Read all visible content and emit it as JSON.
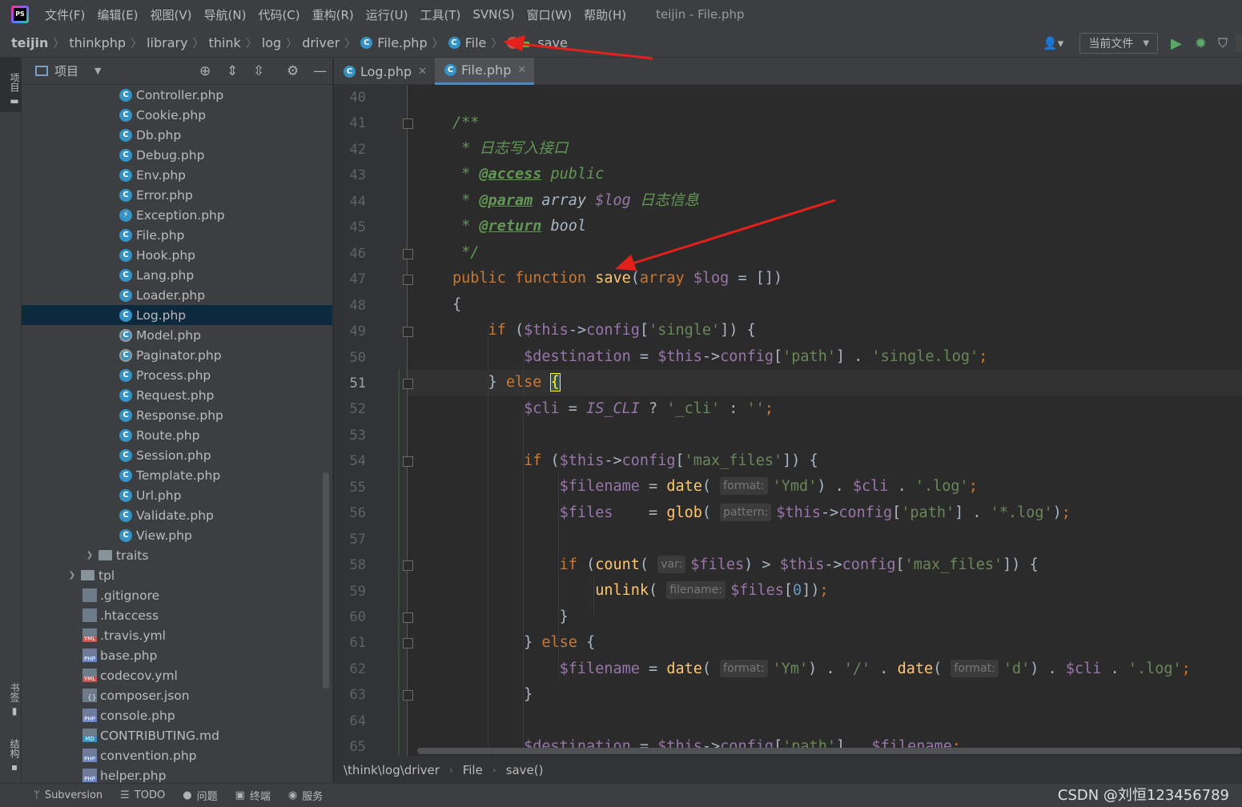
{
  "window_title": "teijin - File.php",
  "menu": [
    "文件(F)",
    "编辑(E)",
    "视图(V)",
    "导航(N)",
    "代码(C)",
    "重构(R)",
    "运行(U)",
    "工具(T)",
    "SVN(S)",
    "窗口(W)",
    "帮助(H)"
  ],
  "navbar": {
    "crumbs": [
      "teijin",
      "thinkphp",
      "library",
      "think",
      "log",
      "driver",
      "File.php",
      "File",
      "save"
    ],
    "run_config": "当前文件"
  },
  "left_stripe": {
    "project": "项目",
    "bookmarks": "书签",
    "structure": "结构"
  },
  "project_panel": {
    "title": "项目",
    "files": [
      "Controller.php",
      "Cookie.php",
      "Db.php",
      "Debug.php",
      "Env.php",
      "Error.php",
      "Exception.php",
      "File.php",
      "Hook.php",
      "Lang.php",
      "Loader.php",
      "Log.php",
      "Model.php",
      "Paginator.php",
      "Process.php",
      "Request.php",
      "Response.php",
      "Route.php",
      "Session.php",
      "Template.php",
      "Url.php",
      "Validate.php",
      "View.php"
    ],
    "folders": [
      "traits",
      "tpl"
    ],
    "root_files": [
      ".gitignore",
      ".htaccess",
      ".travis.yml",
      "base.php",
      "codecov.yml",
      "composer.json",
      "console.php",
      "CONTRIBUTING.md",
      "convention.php",
      "helper.php"
    ],
    "selected": "Log.php"
  },
  "editor_tabs": [
    {
      "label": "Log.php",
      "active": false
    },
    {
      "label": "File.php",
      "active": true
    }
  ],
  "editor": {
    "current_line": 51,
    "line_numbers": [
      "40",
      "41",
      "42",
      "43",
      "44",
      "45",
      "46",
      "47",
      "48",
      "49",
      "50",
      "51",
      "52",
      "53",
      "54",
      "55",
      "56",
      "57",
      "58",
      "59",
      "60",
      "61",
      "62",
      "63",
      "64",
      "65"
    ],
    "comment_cn_1": "日志写入接口",
    "comment_cn_2": "日志信息",
    "hints": {
      "format": "format:",
      "pattern": "pattern:",
      "var": "var:",
      "filename": "filename:"
    }
  },
  "editor_breadcrumb": [
    "\\think\\log\\driver",
    "File",
    "save()"
  ],
  "bottom_tools": [
    "Subversion",
    "TODO",
    "问题",
    "终端",
    "服务"
  ],
  "watermark": "CSDN @刘恒123456789",
  "colors": {
    "keyword": "#cc7832",
    "function": "#ffc66d",
    "variable": "#9876aa",
    "string": "#6a8759",
    "comment": "#629755",
    "annotation_arrow": "#e3201b"
  }
}
